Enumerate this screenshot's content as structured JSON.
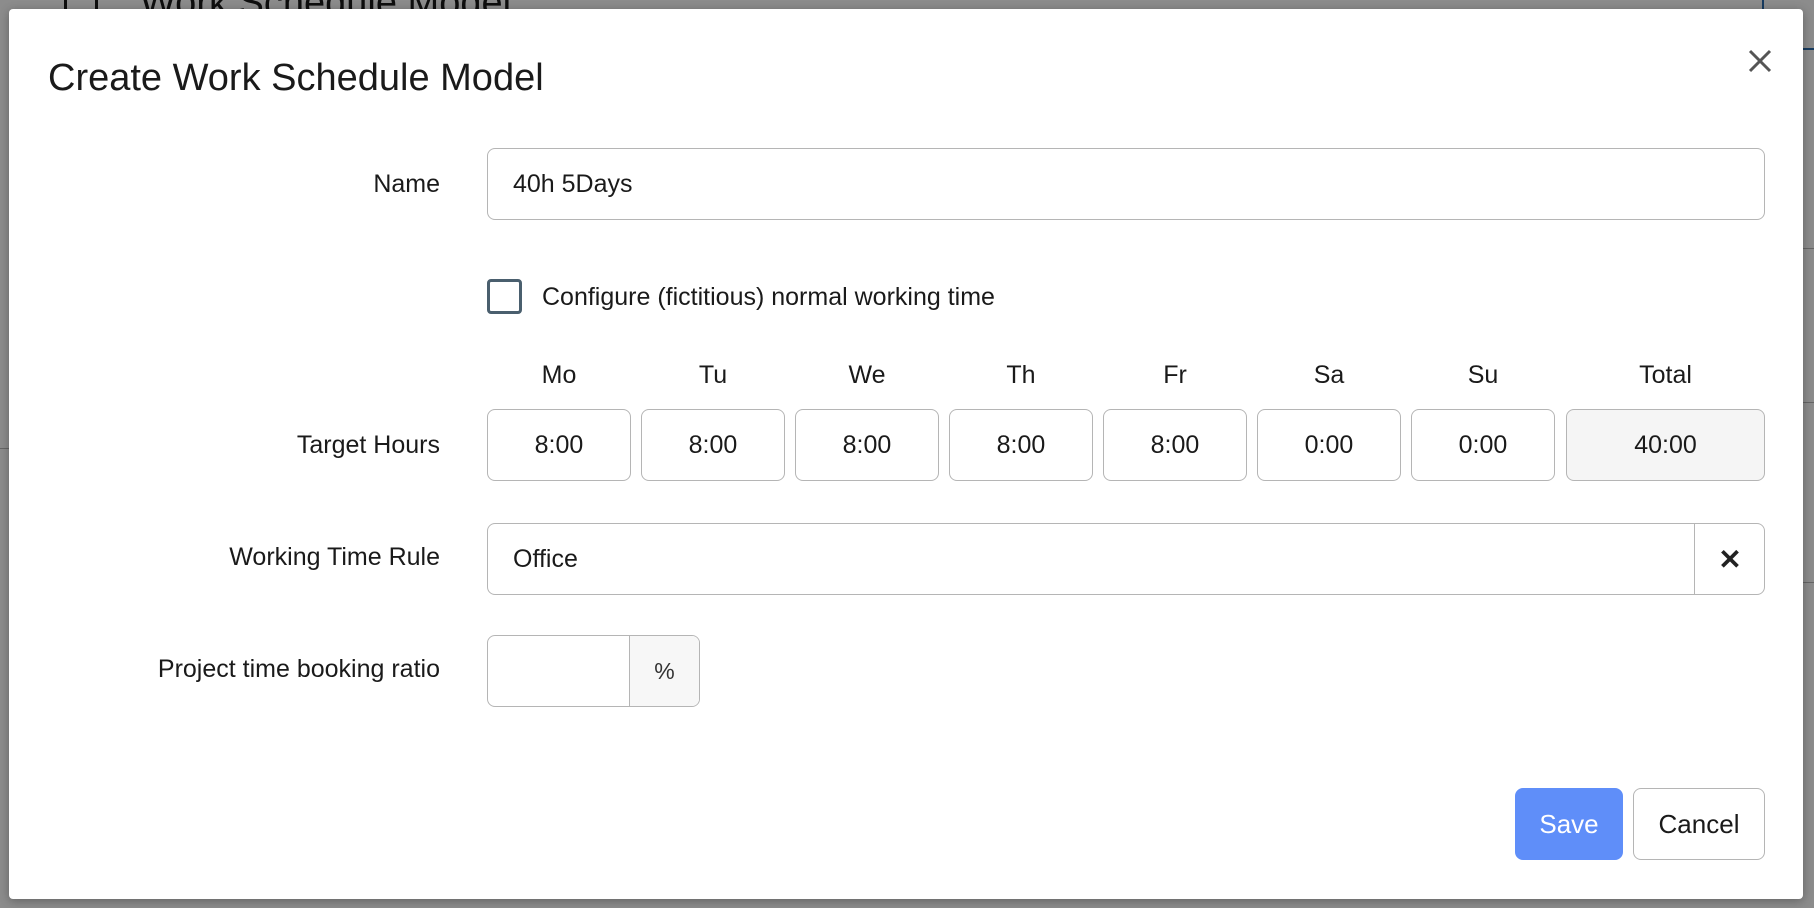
{
  "background": {
    "title": "Work Schedule Model"
  },
  "dialog": {
    "title": "Create Work Schedule Model",
    "name_label": "Name",
    "name_value": "40h 5Days",
    "normal_time_checkbox_label": "Configure (fictitious) normal working time",
    "normal_time_checked": false,
    "target_hours_label": "Target Hours",
    "days": [
      {
        "header": "Mo",
        "value": "8:00"
      },
      {
        "header": "Tu",
        "value": "8:00"
      },
      {
        "header": "We",
        "value": "8:00"
      },
      {
        "header": "Th",
        "value": "8:00"
      },
      {
        "header": "Fr",
        "value": "8:00"
      },
      {
        "header": "Sa",
        "value": "0:00"
      },
      {
        "header": "Su",
        "value": "0:00"
      }
    ],
    "total": {
      "header": "Total",
      "value": "40:00"
    },
    "working_time_rule_label": "Working Time Rule",
    "working_time_rule_value": "Office",
    "project_ratio_label": "Project time booking ratio",
    "project_ratio_value": "",
    "project_ratio_unit": "%",
    "save_label": "Save",
    "cancel_label": "Cancel"
  },
  "colors": {
    "primary": "#5f8ef9",
    "border": "#b5b5b5",
    "checkbox_border": "#4a5f6e"
  }
}
